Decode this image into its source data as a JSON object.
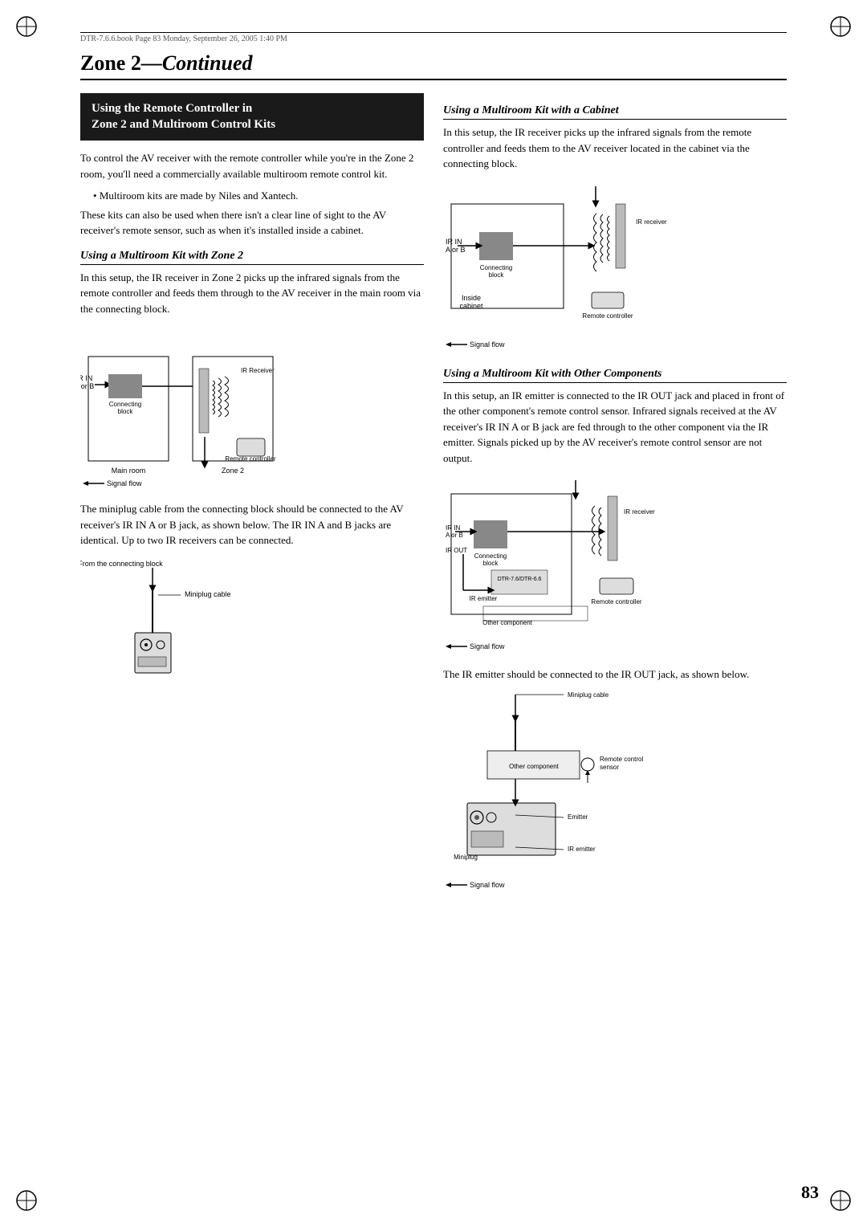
{
  "header": {
    "file_info": "DTR-7.6.6.book  Page 83  Monday, September 26, 2005  1:40 PM"
  },
  "page_title": "Zone 2",
  "page_title_suffix": "—Continued",
  "left_col": {
    "section_box": {
      "line1": "Using the Remote Controller in",
      "line2": "Zone 2 and Multiroom Control Kits"
    },
    "intro_text": "To control the AV receiver with the remote controller while you're in the Zone 2 room, you'll need a commercially available multiroom remote control kit.",
    "bullet": "Multiroom kits are made by Niles and Xantech.",
    "follow_text": "These kits can also be used when there isn't a clear line of sight to the AV receiver's remote sensor, such as when it's installed inside a cabinet.",
    "subsec1_heading": "Using a Multiroom Kit with Zone 2",
    "subsec1_text": "In this setup, the IR receiver in Zone 2 picks up the infrared signals from the remote controller and feeds them through to the AV receiver in the main room via the connecting block.",
    "diagram1_labels": {
      "ir_in": "IR IN\nA or B",
      "connecting_block": "Connecting\nblock",
      "ir_receiver": "IR Receiver",
      "remote_controller": "Remote controller",
      "main_room": "Main room",
      "zone2": "Zone 2",
      "signal_flow": "Signal flow"
    },
    "subsec2_text": "The miniplug cable from the connecting block should be connected to the AV receiver's IR IN A or B jack, as shown below. The IR IN A and B jacks are identical. Up to two IR receivers can be connected.",
    "diagram2_labels": {
      "from_connecting_block": "From the connecting block",
      "miniplug_cable": "Miniplug cable"
    }
  },
  "right_col": {
    "subsec1_heading": "Using a Multiroom Kit with a Cabinet",
    "subsec1_text": "In this setup, the IR receiver picks up the infrared signals from the remote controller and feeds them to the AV receiver located in the cabinet via the connecting block.",
    "diagram1_labels": {
      "connecting_block": "Connecting\nblock",
      "ir_receiver": "IR receiver",
      "ir_in": "IR IN\nA or B",
      "inside_cabinet": "Inside\ncabinet",
      "remote_controller": "Remote controller",
      "signal_flow": "Signal flow"
    },
    "subsec2_heading": "Using a Multiroom Kit with Other Components",
    "subsec2_text": "In this setup, an IR emitter is connected to the IR OUT jack and placed in front of the other component's remote control sensor. Infrared signals received at the AV receiver's IR IN A or B jack are fed through to the other component via the IR emitter. Signals picked up by the AV receiver's remote control sensor are not output.",
    "diagram2_labels": {
      "connecting_block": "Connecting\nblock",
      "ir_receiver": "IR receiver",
      "ir_in": "IR IN\nA or B",
      "ir_out": "IR OUT",
      "dtr": "DTR-7.6/DTR-6.6",
      "ir_emitter": "IR emitter",
      "remote_controller": "Remote controller",
      "other_component": "Other component",
      "signal_flow": "Signal flow"
    },
    "subsec3_text": "The IR emitter should be connected to the IR OUT jack, as shown below.",
    "diagram3_labels": {
      "miniplug_cable": "Miniplug cable",
      "other_component": "Other component",
      "remote_control_sensor": "Remote control\nsensor",
      "emitter": "Emitter",
      "miniplug": "Miniplug",
      "ir_emitter": "IR emitter",
      "signal_flow": "Signal flow"
    }
  },
  "page_number": "83"
}
